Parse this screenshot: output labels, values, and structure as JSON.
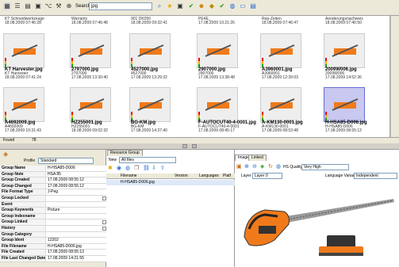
{
  "toolbar": {
    "search_label": "Search",
    "search_value": "jpg"
  },
  "gallery": {
    "header_items": [
      {
        "title": "KT Schneidwerkzeuge",
        "date": "18.08.2009 07:46:28"
      },
      {
        "title": "Warranty",
        "date": "18.08.2009 07:46:48"
      },
      {
        "title": "901 DK050",
        "date": "18.08.2009 09:32:41"
      },
      {
        "title": "PE4E_",
        "date": "17.08.2009 10:21:26"
      },
      {
        "title": "Rep-Zeiten",
        "date": "18.08.2009 07:46:47"
      },
      {
        "title": "Aenderungsnachweis",
        "date": "18.08.2009 07:46:50"
      }
    ],
    "row1": [
      {
        "name": "KT Harvester.jpg",
        "sub": "KT Harvester",
        "date": "18.08.2009 07:41:24"
      },
      {
        "name": "2797000.jpg",
        "sub": "2797000",
        "date": "17.08.2009 13:30:40"
      },
      {
        "name": "4527000.jpg",
        "sub": "4527000",
        "date": "17.08.2009 13:29:32"
      },
      {
        "name": "2907000.jpg",
        "sub": "2907000",
        "date": "17.08.2009 13:38:48"
      },
      {
        "name": "A3960001.jpg",
        "sub": "A3960001",
        "date": "17.08.2009 12:39:03"
      },
      {
        "name": "2009W006.jpg",
        "sub": "2009W006",
        "date": "17.08.2009 14:52:36"
      }
    ],
    "row2": [
      {
        "name": "A4692009.jpg",
        "sub": "A4692009",
        "date": "17.08.2009 10:31:43"
      },
      {
        "name": "HZ255001.jpg",
        "sub": "HZ255001",
        "date": "18.08.2009 09:02:32"
      },
      {
        "name": "BG-KM.jpg",
        "sub": "BG-KM",
        "date": "17.08.2009 14:37:40"
      },
      {
        "name": "F-AUTOCUT40-4-0001.jpg",
        "sub": "F-AUTOCUT40-4-0001",
        "date": "17.08.2009 08:45:17"
      },
      {
        "name": "A-KM130-0001.jpg",
        "sub": "A-KM130-0001",
        "date": "17.08.2009 08:53:48"
      },
      {
        "name": "H-HSA85-D006.jpg",
        "sub": "H-HSA85-D006",
        "date": "17.08.2009 08:55:12"
      }
    ]
  },
  "status": {
    "found_label": "Found",
    "found_count": "78"
  },
  "left_panel": {
    "profile_label": "Profile",
    "profile_value": "Standard",
    "rows": [
      {
        "k": "Group Name",
        "v": "H-HSA85-D006"
      },
      {
        "k": "Group Note",
        "v": "HSA 85"
      },
      {
        "k": "Group Created",
        "v": "17.08.2009 08:55:12"
      },
      {
        "k": "Group Changed",
        "v": "17.08.2009 08:55:12"
      },
      {
        "k": "File Format Type",
        "v": "J-Peg"
      },
      {
        "k": "Group Locked",
        "v": ""
      },
      {
        "k": "Event",
        "v": ""
      },
      {
        "k": "Group Keywords",
        "v": "Picture"
      },
      {
        "k": "Group Indexname",
        "v": ""
      },
      {
        "k": "Group Linked",
        "v": ""
      },
      {
        "k": "History",
        "v": ""
      },
      {
        "k": "Group Category",
        "v": ""
      },
      {
        "k": "Group Ident",
        "v": "12202"
      },
      {
        "k": "File Filename",
        "v": "H-HSA85-D006.jpg"
      },
      {
        "k": "File Created",
        "v": "17.08.2009 08:55:13"
      },
      {
        "k": "File Last Changed Date",
        "v": "17.08.2009 14:21:55"
      }
    ]
  },
  "middle_panel": {
    "tab": "Resource Group",
    "new_label": "New",
    "filter_value": "All files",
    "columns": [
      "Filename",
      "Version",
      "Languages",
      "Platf"
    ],
    "rows": [
      {
        "filename": "H-HSA85-D006.jpg",
        "version": "",
        "languages": "",
        "platform": ""
      }
    ]
  },
  "right_panel": {
    "tabs": [
      "Image",
      "Linked"
    ],
    "hs_quality_label": "HS Quality",
    "quality_value": "Very High",
    "layer_label": "Layer",
    "layer_value": "Layer 0",
    "language_variant_label": "Language Variant",
    "language_variant_value": "Independent"
  }
}
